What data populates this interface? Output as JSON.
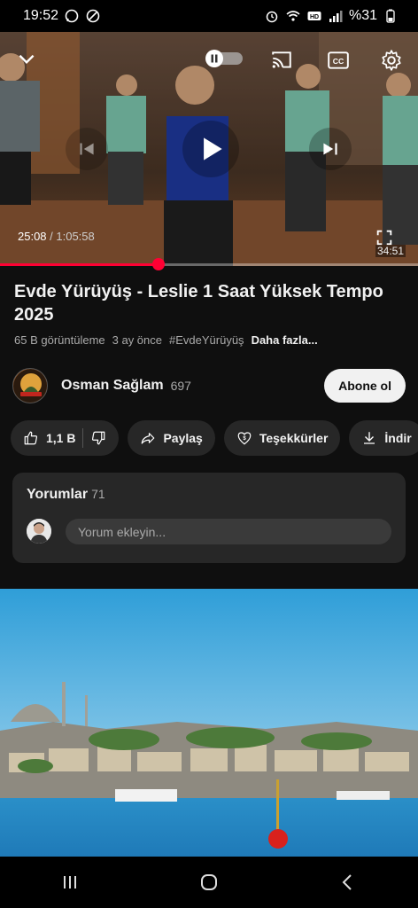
{
  "status_bar": {
    "time": "19:52",
    "battery": "%31",
    "icons": [
      "whatsapp-icon",
      "dnd-icon",
      "alarm-icon",
      "wifi-icon",
      "hd-icon",
      "signal-icon"
    ]
  },
  "player": {
    "current_time": "25:08",
    "total_time": " / 1:05:58",
    "remaining_overlay": "34:51",
    "progress": 0.38,
    "icons": [
      "chevron-down-icon",
      "autoplay-toggle-icon",
      "cast-icon",
      "captions-icon",
      "settings-icon",
      "previous-icon",
      "play-icon",
      "next-icon",
      "fullscreen-icon"
    ]
  },
  "video": {
    "title": "Evde Yürüyüş - Leslie 1 Saat Yüksek Tempo 2025",
    "views": "65 B görüntüleme",
    "age": "3 ay önce",
    "hashtag": "#EvdeYürüyüş",
    "more": "Daha fazla..."
  },
  "channel": {
    "name": "Osman Sağlam",
    "subscribers": "697",
    "subscribe_label": "Abone ol"
  },
  "actions": {
    "likes": "1,1 B",
    "share": "Paylaş",
    "thanks": "Teşekkürler",
    "download": "İndir"
  },
  "comments": {
    "title": "Yorumlar",
    "count": "71",
    "placeholder": "Yorum ekleyin..."
  },
  "colors": {
    "accent": "#ff0033",
    "background": "#0f0f0f",
    "surface": "#272727"
  }
}
